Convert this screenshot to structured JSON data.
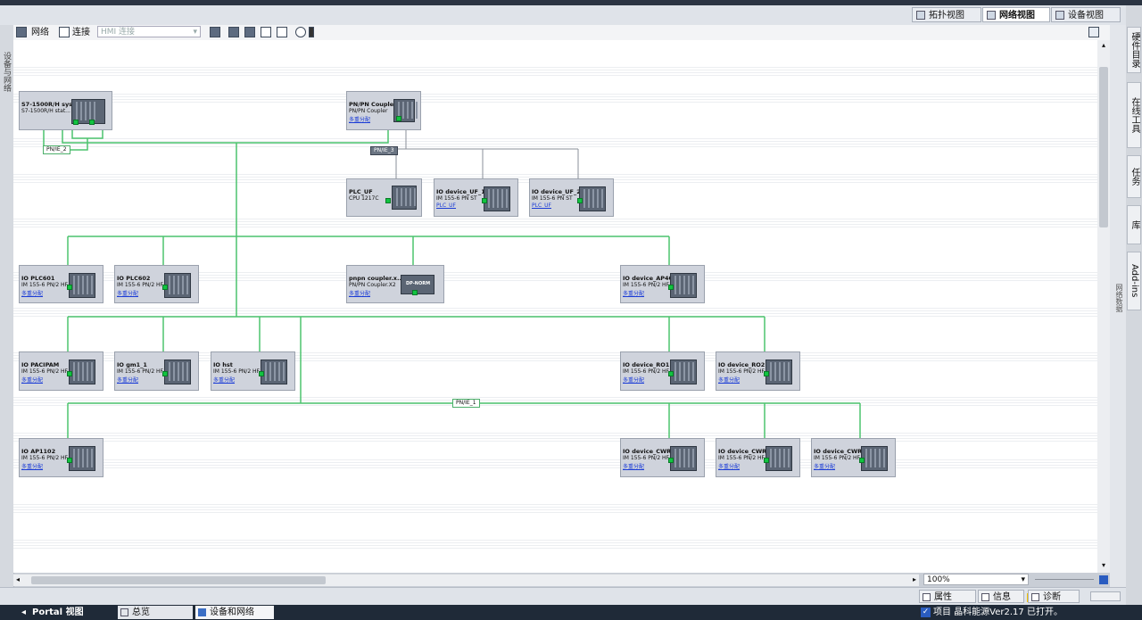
{
  "view_tabs": [
    {
      "label": "拓扑视图",
      "icon": "topology-icon"
    },
    {
      "label": "网络视图",
      "icon": "network-icon"
    },
    {
      "label": "设备视图",
      "icon": "device-icon"
    }
  ],
  "toolbar": {
    "network": "网络",
    "connection": "连接",
    "hmi_placeholder": "HMI 连接",
    "hmi_value": "HMI 连接"
  },
  "left_panel": {
    "label": "设备与网络"
  },
  "right_tabs": [
    "硬件目录",
    "在线工具",
    "任务",
    "库",
    "Add-ins"
  ],
  "right_pane_label": "网络数据",
  "zoom": "100%",
  "properties_tabs": [
    {
      "label": "属性"
    },
    {
      "label": "信息"
    },
    {
      "label": "诊断"
    }
  ],
  "taskbar": {
    "portal": "Portal 视图",
    "overview": "总览",
    "devices": "设备和网络",
    "status": "项目 晶科能源Ver2.17 已打开。"
  },
  "networks": [
    {
      "name": "PN/IE_2"
    },
    {
      "name": "PN/IE_3"
    },
    {
      "name": "PN/IE_1"
    }
  ],
  "devices": [
    {
      "name": "S7-1500R/H sys...",
      "type": "S7-1500R/H stat...",
      "link": ""
    },
    {
      "name": "PN/PN Coupler",
      "type": "PN/PN Coupler",
      "link": "多重分配"
    },
    {
      "name": "PLC_UF",
      "type": "CPU 1217C",
      "link": ""
    },
    {
      "name": "IO device_UF_1",
      "type": "IM 155-6 PN ST",
      "link": "PLC_UF"
    },
    {
      "name": "IO device_UF_2",
      "type": "IM 155-6 PN ST",
      "link": "PLC_UF"
    },
    {
      "name": "IO PLC601",
      "type": "IM 155-6 PN/2 HF",
      "link": "多重分配"
    },
    {
      "name": "IO PLC602",
      "type": "IM 155-6 PN/2 HF",
      "link": "多重分配"
    },
    {
      "name": "pnpn coupler.x...",
      "type": "PN/PN Coupler.X2",
      "link": "多重分配",
      "badge": "DP-NORM"
    },
    {
      "name": "IO device_AP401",
      "type": "IM 155-6 PN/2 HF",
      "link": "多重分配"
    },
    {
      "name": "IO PACIPAM",
      "type": "IM 155-6 PN/2 HF",
      "link": "多重分配"
    },
    {
      "name": "IO gm1_1",
      "type": "IM 155-6 PN/2 HF",
      "link": "多重分配"
    },
    {
      "name": "IO hst",
      "type": "IM 155-6 PN/2 HF",
      "link": "多重分配"
    },
    {
      "name": "IO device_RO1",
      "type": "IM 155-6 PN/2 HF",
      "link": "多重分配"
    },
    {
      "name": "IO device_RO2",
      "type": "IM 155-6 PN/2 HF",
      "link": "多重分配"
    },
    {
      "name": "IO AP1102",
      "type": "IM 155-6 PN/2 HF",
      "link": "多重分配"
    },
    {
      "name": "IO device_CWR...",
      "type": "IM 155-6 PN/2 HF",
      "link": "多重分配"
    },
    {
      "name": "IO device_CWR...",
      "type": "IM 155-6 PN/2 HF",
      "link": "多重分配"
    },
    {
      "name": "IO device_CWR...",
      "type": "IM 155-6 PN/2 HF",
      "link": "多重分配"
    }
  ],
  "colors": {
    "net_green": "#4cc46e",
    "net_grey": "#8a8f98",
    "link_blue": "#1a3bd6",
    "device_bg": "#cfd3dc"
  }
}
